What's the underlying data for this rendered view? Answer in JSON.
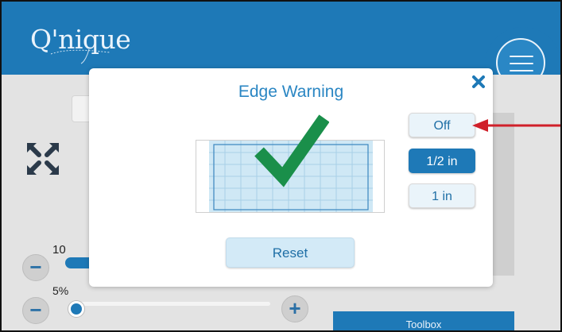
{
  "app": {
    "logo_text": "Q'nique"
  },
  "header": {
    "menu_icon": "hamburger-menu-icon"
  },
  "background": {
    "zoom_value_label": "10",
    "percent_label": "5%",
    "toolbox_label": "Toolbox",
    "minus_symbol": "−",
    "plus_symbol": "+",
    "slider_value_percent": 5
  },
  "dialog": {
    "title": "Edge Warning",
    "close_icon": "close-icon",
    "options": [
      {
        "label": "Off",
        "selected": false
      },
      {
        "label": "1/2 in",
        "selected": true
      },
      {
        "label": "1 in",
        "selected": false
      }
    ],
    "reset_label": "Reset",
    "preview_icon": "checkmark-icon"
  },
  "annotation": {
    "icon": "red-arrow-pointer"
  },
  "colors": {
    "brand_blue": "#1e79b7",
    "check_green": "#1a8f4a",
    "arrow_red": "#d0202a",
    "light_blue": "#d3eaf7"
  }
}
